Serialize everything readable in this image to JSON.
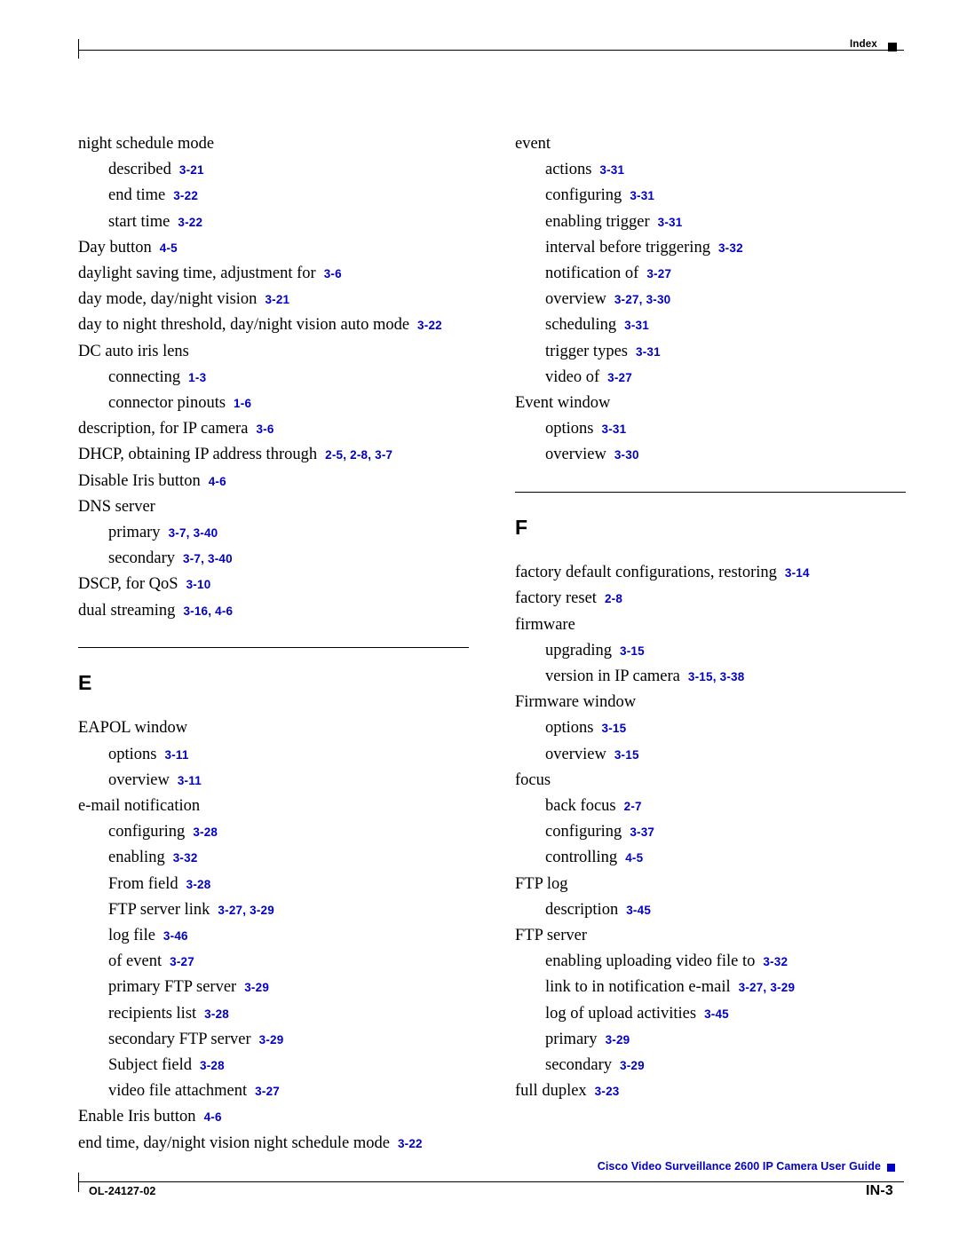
{
  "header": {
    "label": "Index",
    "marker_icon": "black-square-icon"
  },
  "footer": {
    "guide_title": "Cisco Video Surveillance 2600 IP Camera User Guide",
    "marker_icon": "blue-square-icon",
    "doc_id": "OL-24127-02",
    "page_number": "IN-3"
  },
  "columns": {
    "left": {
      "blocks": [
        {
          "type": "entries",
          "entries": [
            {
              "level": 0,
              "text": "night schedule mode",
              "pages": ""
            },
            {
              "level": 1,
              "text": "described",
              "pages": "3-21"
            },
            {
              "level": 1,
              "text": "end time",
              "pages": "3-22"
            },
            {
              "level": 1,
              "text": "start time",
              "pages": "3-22"
            },
            {
              "level": 0,
              "text": "Day button",
              "pages": "4-5"
            },
            {
              "level": 0,
              "text": "daylight saving time, adjustment for",
              "pages": "3-6"
            },
            {
              "level": 0,
              "text": "day mode, day/night vision",
              "pages": "3-21"
            },
            {
              "level": 0,
              "text": "day to night threshold, day/night vision auto mode",
              "pages": "3-22"
            },
            {
              "level": 0,
              "text": "DC auto iris lens",
              "pages": ""
            },
            {
              "level": 1,
              "text": "connecting",
              "pages": "1-3"
            },
            {
              "level": 1,
              "text": "connector pinouts",
              "pages": "1-6"
            },
            {
              "level": 0,
              "text": "description, for IP camera",
              "pages": "3-6"
            },
            {
              "level": 0,
              "text": "DHCP, obtaining IP address through",
              "pages": "2-5, 2-8, 3-7"
            },
            {
              "level": 0,
              "text": "Disable Iris button",
              "pages": "4-6"
            },
            {
              "level": 0,
              "text": "DNS server",
              "pages": ""
            },
            {
              "level": 1,
              "text": "primary",
              "pages": "3-7, 3-40"
            },
            {
              "level": 1,
              "text": "secondary",
              "pages": "3-7, 3-40"
            },
            {
              "level": 0,
              "text": "DSCP, for QoS",
              "pages": "3-10"
            },
            {
              "level": 0,
              "text": "dual streaming",
              "pages": "3-16, 4-6"
            }
          ]
        },
        {
          "type": "section",
          "letter": "E",
          "entries": [
            {
              "level": 0,
              "text": "EAPOL window",
              "pages": ""
            },
            {
              "level": 1,
              "text": "options",
              "pages": "3-11"
            },
            {
              "level": 1,
              "text": "overview",
              "pages": "3-11"
            },
            {
              "level": 0,
              "text": "e-mail notification",
              "pages": ""
            },
            {
              "level": 1,
              "text": "configuring",
              "pages": "3-28"
            },
            {
              "level": 1,
              "text": "enabling",
              "pages": "3-32"
            },
            {
              "level": 1,
              "text": "From field",
              "pages": "3-28"
            },
            {
              "level": 1,
              "text": "FTP server link",
              "pages": "3-27, 3-29"
            },
            {
              "level": 1,
              "text": "log file",
              "pages": "3-46"
            },
            {
              "level": 1,
              "text": "of event",
              "pages": "3-27"
            },
            {
              "level": 1,
              "text": "primary FTP server",
              "pages": "3-29"
            },
            {
              "level": 1,
              "text": "recipients list",
              "pages": "3-28"
            },
            {
              "level": 1,
              "text": "secondary FTP server",
              "pages": "3-29"
            },
            {
              "level": 1,
              "text": "Subject field",
              "pages": "3-28"
            },
            {
              "level": 1,
              "text": "video file attachment",
              "pages": "3-27"
            },
            {
              "level": 0,
              "text": "Enable Iris button",
              "pages": "4-6"
            },
            {
              "level": 0,
              "text": "end time, day/night vision night schedule mode",
              "pages": "3-22"
            }
          ]
        }
      ]
    },
    "right": {
      "blocks": [
        {
          "type": "entries",
          "entries": [
            {
              "level": 0,
              "text": "event",
              "pages": ""
            },
            {
              "level": 1,
              "text": "actions",
              "pages": "3-31"
            },
            {
              "level": 1,
              "text": "configuring",
              "pages": "3-31"
            },
            {
              "level": 1,
              "text": "enabling trigger",
              "pages": "3-31"
            },
            {
              "level": 1,
              "text": "interval before triggering",
              "pages": "3-32"
            },
            {
              "level": 1,
              "text": "notification of",
              "pages": "3-27"
            },
            {
              "level": 1,
              "text": "overview",
              "pages": "3-27, 3-30"
            },
            {
              "level": 1,
              "text": "scheduling",
              "pages": "3-31"
            },
            {
              "level": 1,
              "text": "trigger types",
              "pages": "3-31"
            },
            {
              "level": 1,
              "text": "video of",
              "pages": "3-27"
            },
            {
              "level": 0,
              "text": "Event window",
              "pages": ""
            },
            {
              "level": 1,
              "text": "options",
              "pages": "3-31"
            },
            {
              "level": 1,
              "text": "overview",
              "pages": "3-30"
            }
          ]
        },
        {
          "type": "section",
          "letter": "F",
          "entries": [
            {
              "level": 0,
              "text": "factory default configurations, restoring",
              "pages": "3-14"
            },
            {
              "level": 0,
              "text": "factory reset",
              "pages": "2-8"
            },
            {
              "level": 0,
              "text": "firmware",
              "pages": ""
            },
            {
              "level": 1,
              "text": "upgrading",
              "pages": "3-15"
            },
            {
              "level": 1,
              "text": "version in IP camera",
              "pages": "3-15, 3-38"
            },
            {
              "level": 0,
              "text": "Firmware window",
              "pages": ""
            },
            {
              "level": 1,
              "text": "options",
              "pages": "3-15"
            },
            {
              "level": 1,
              "text": "overview",
              "pages": "3-15"
            },
            {
              "level": 0,
              "text": "focus",
              "pages": ""
            },
            {
              "level": 1,
              "text": "back focus",
              "pages": "2-7"
            },
            {
              "level": 1,
              "text": "configuring",
              "pages": "3-37"
            },
            {
              "level": 1,
              "text": "controlling",
              "pages": "4-5"
            },
            {
              "level": 0,
              "text": "FTP log",
              "pages": ""
            },
            {
              "level": 1,
              "text": "description",
              "pages": "3-45"
            },
            {
              "level": 0,
              "text": "FTP server",
              "pages": ""
            },
            {
              "level": 1,
              "text": "enabling uploading video file to",
              "pages": "3-32"
            },
            {
              "level": 1,
              "text": "link to in notification e-mail",
              "pages": "3-27, 3-29"
            },
            {
              "level": 1,
              "text": "log of upload activities",
              "pages": "3-45"
            },
            {
              "level": 1,
              "text": "primary",
              "pages": "3-29"
            },
            {
              "level": 1,
              "text": "secondary",
              "pages": "3-29"
            },
            {
              "level": 0,
              "text": "full duplex",
              "pages": "3-23"
            }
          ]
        }
      ]
    }
  }
}
